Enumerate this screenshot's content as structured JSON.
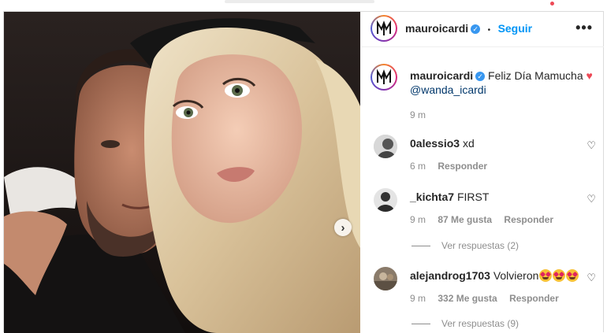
{
  "post": {
    "username": "mauroicardi",
    "follow_label": "Seguir",
    "dot_separator": "•",
    "more_label": "•••",
    "next_arrow": "›",
    "verified_glyph": "✓"
  },
  "caption": {
    "username": "mauroicardi",
    "text": "Feliz Día Mamucha",
    "mention": "@wanda_icardi",
    "time": "9 m",
    "heart": "♥"
  },
  "comments": [
    {
      "username": "0alessio3",
      "text": "xd",
      "time": "6 m",
      "likes": "",
      "reply": "Responder",
      "view_replies": ""
    },
    {
      "username": "_kichta7",
      "text": "FIRST",
      "time": "9 m",
      "likes": "87 Me gusta",
      "reply": "Responder",
      "view_replies": "Ver respuestas (2)"
    },
    {
      "username": "alejandrog1703",
      "text": "Volvieron",
      "time": "9 m",
      "likes": "332 Me gusta",
      "reply": "Responder",
      "view_replies": "Ver respuestas (9)"
    }
  ],
  "icons": {
    "like": "♡",
    "verified": "verified-badge-icon"
  },
  "colors": {
    "follow": "#0095f6",
    "verified": "#3897f0",
    "heart": "#ed4956",
    "meta": "#8e8e8e"
  }
}
